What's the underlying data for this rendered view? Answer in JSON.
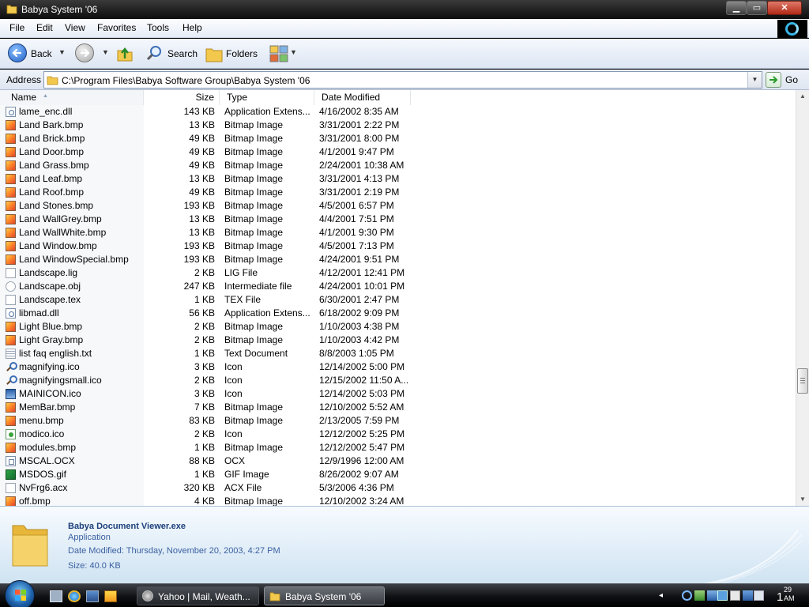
{
  "window": {
    "title": "Babya System '06"
  },
  "menu": [
    "File",
    "Edit",
    "View",
    "Favorites",
    "Tools",
    "Help"
  ],
  "toolbar": {
    "back_label": "Back",
    "search_label": "Search",
    "folders_label": "Folders"
  },
  "address": {
    "label": "Address",
    "value": "C:\\Program Files\\Babya Software Group\\Babya System '06",
    "go_label": "Go"
  },
  "columns": {
    "name": "Name",
    "size": "Size",
    "type": "Type",
    "date": "Date Modified"
  },
  "files": [
    {
      "name": "lame_enc.dll",
      "size": "143 KB",
      "type": "Application Extens...",
      "date": "4/16/2002 8:35 AM",
      "icon": "dll"
    },
    {
      "name": "Land Bark.bmp",
      "size": "13 KB",
      "type": "Bitmap Image",
      "date": "3/31/2001 2:22 PM",
      "icon": "bmp"
    },
    {
      "name": "Land Brick.bmp",
      "size": "49 KB",
      "type": "Bitmap Image",
      "date": "3/31/2001 8:00 PM",
      "icon": "bmp"
    },
    {
      "name": "Land Door.bmp",
      "size": "49 KB",
      "type": "Bitmap Image",
      "date": "4/1/2001 9:47 PM",
      "icon": "bmp"
    },
    {
      "name": "Land Grass.bmp",
      "size": "49 KB",
      "type": "Bitmap Image",
      "date": "2/24/2001 10:38 AM",
      "icon": "bmp"
    },
    {
      "name": "Land Leaf.bmp",
      "size": "13 KB",
      "type": "Bitmap Image",
      "date": "3/31/2001 4:13 PM",
      "icon": "bmp"
    },
    {
      "name": "Land Roof.bmp",
      "size": "49 KB",
      "type": "Bitmap Image",
      "date": "3/31/2001 2:19 PM",
      "icon": "bmp"
    },
    {
      "name": "Land Stones.bmp",
      "size": "193 KB",
      "type": "Bitmap Image",
      "date": "4/5/2001 6:57 PM",
      "icon": "bmp"
    },
    {
      "name": "Land WallGrey.bmp",
      "size": "13 KB",
      "type": "Bitmap Image",
      "date": "4/4/2001 7:51 PM",
      "icon": "bmp"
    },
    {
      "name": "Land WallWhite.bmp",
      "size": "13 KB",
      "type": "Bitmap Image",
      "date": "4/1/2001 9:30 PM",
      "icon": "bmp"
    },
    {
      "name": "Land Window.bmp",
      "size": "193 KB",
      "type": "Bitmap Image",
      "date": "4/5/2001 7:13 PM",
      "icon": "bmp"
    },
    {
      "name": "Land WindowSpecial.bmp",
      "size": "193 KB",
      "type": "Bitmap Image",
      "date": "4/24/2001 9:51 PM",
      "icon": "bmp"
    },
    {
      "name": "Landscape.lig",
      "size": "2 KB",
      "type": "LIG File",
      "date": "4/12/2001 12:41 PM",
      "icon": "file"
    },
    {
      "name": "Landscape.obj",
      "size": "247 KB",
      "type": "Intermediate file",
      "date": "4/24/2001 10:01 PM",
      "icon": "obj"
    },
    {
      "name": "Landscape.tex",
      "size": "1 KB",
      "type": "TEX File",
      "date": "6/30/2001 2:47 PM",
      "icon": "file"
    },
    {
      "name": "libmad.dll",
      "size": "56 KB",
      "type": "Application Extens...",
      "date": "6/18/2002 9:09 PM",
      "icon": "dll"
    },
    {
      "name": "Light Blue.bmp",
      "size": "2 KB",
      "type": "Bitmap Image",
      "date": "1/10/2003 4:38 PM",
      "icon": "bmp"
    },
    {
      "name": "Light Gray.bmp",
      "size": "2 KB",
      "type": "Bitmap Image",
      "date": "1/10/2003 4:42 PM",
      "icon": "bmp"
    },
    {
      "name": "list faq english.txt",
      "size": "1 KB",
      "type": "Text Document",
      "date": "8/8/2003 1:05 PM",
      "icon": "txt"
    },
    {
      "name": "magnifying.ico",
      "size": "3 KB",
      "type": "Icon",
      "date": "12/14/2002 5:00 PM",
      "icon": "mag"
    },
    {
      "name": "magnifyingsmall.ico",
      "size": "2 KB",
      "type": "Icon",
      "date": "12/15/2002 11:50 A...",
      "icon": "mag"
    },
    {
      "name": "MAINICON.ico",
      "size": "3 KB",
      "type": "Icon",
      "date": "12/14/2002 5:03 PM",
      "icon": "winico"
    },
    {
      "name": "MemBar.bmp",
      "size": "7 KB",
      "type": "Bitmap Image",
      "date": "12/10/2002 5:52 AM",
      "icon": "bmp"
    },
    {
      "name": "menu.bmp",
      "size": "83 KB",
      "type": "Bitmap Image",
      "date": "2/13/2005 7:59 PM",
      "icon": "bmp"
    },
    {
      "name": "modico.ico",
      "size": "2 KB",
      "type": "Icon",
      "date": "12/12/2002 5:25 PM",
      "icon": "modico"
    },
    {
      "name": "modules.bmp",
      "size": "1 KB",
      "type": "Bitmap Image",
      "date": "12/12/2002 5:47 PM",
      "icon": "bmp"
    },
    {
      "name": "MSCAL.OCX",
      "size": "88 KB",
      "type": "OCX",
      "date": "12/9/1996 12:00 AM",
      "icon": "ocx"
    },
    {
      "name": "MSDOS.gif",
      "size": "1 KB",
      "type": "GIF Image",
      "date": "8/26/2002 9:07 AM",
      "icon": "gif"
    },
    {
      "name": "NvFrg6.acx",
      "size": "320 KB",
      "type": "ACX File",
      "date": "5/3/2006 4:36 PM",
      "icon": "file"
    },
    {
      "name": "off.bmp",
      "size": "4 KB",
      "type": "Bitmap Image",
      "date": "12/10/2002 3:24 AM",
      "icon": "bmp"
    }
  ],
  "details": {
    "name": "Babya Document Viewer.exe",
    "type": "Application",
    "modified": "Date Modified: Thursday, November 20, 2003, 4:27 PM",
    "size": "Size: 40.0 KB"
  },
  "taskbar": {
    "tasks": [
      {
        "label": "Yahoo | Mail, Weath..."
      },
      {
        "label": "Babya System '06"
      }
    ],
    "clock": {
      "hour": "1",
      "minute": "29",
      "ampm": "AM"
    }
  }
}
